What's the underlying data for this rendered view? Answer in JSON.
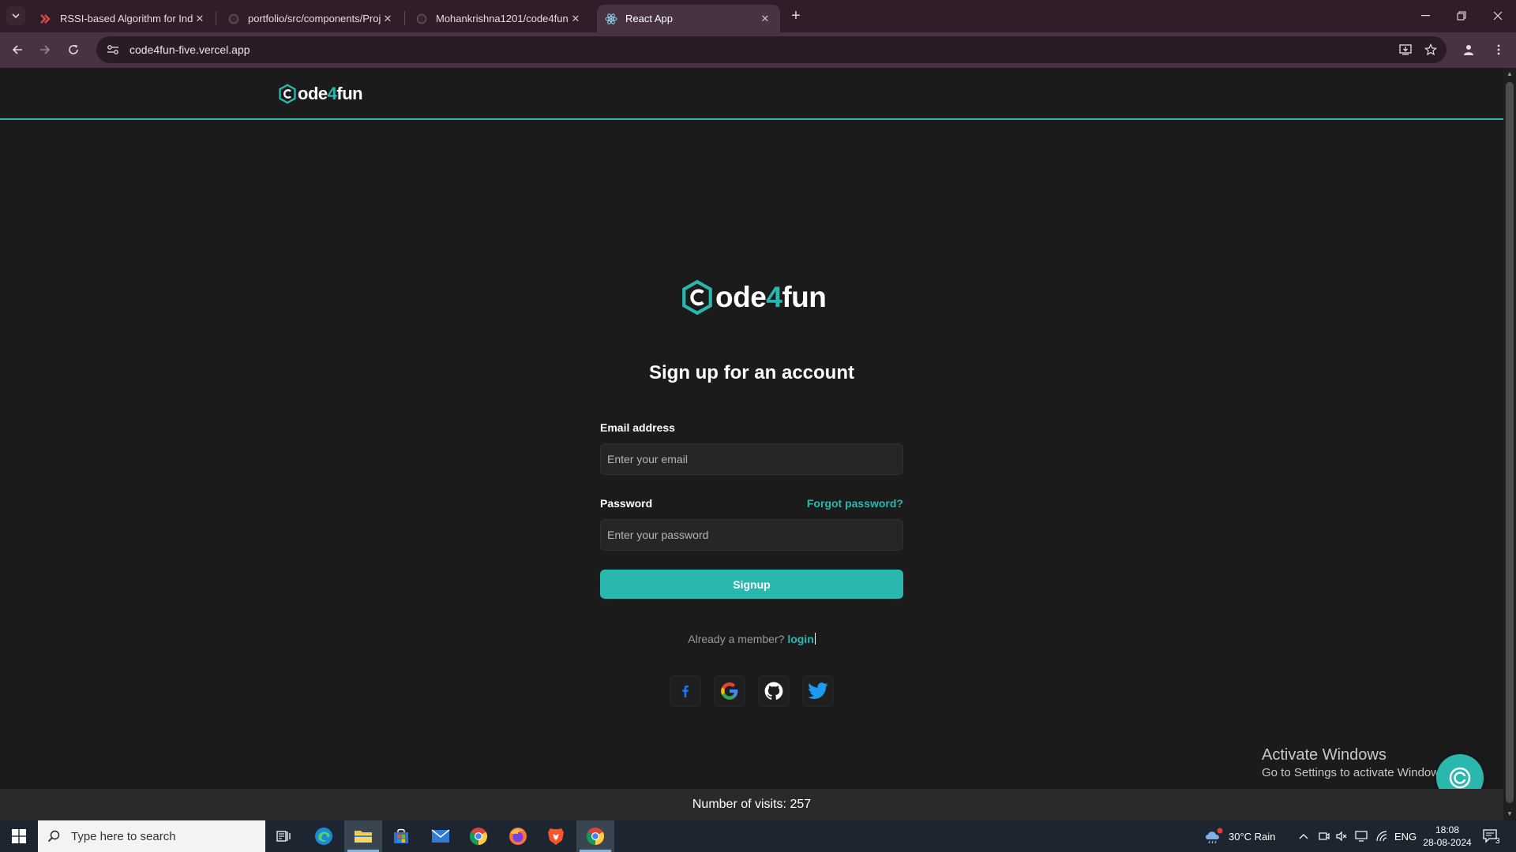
{
  "browser": {
    "tabs": [
      {
        "title": "RSSI-based Algorithm for Indoor",
        "active": false
      },
      {
        "title": "portfolio/src/components/Proje",
        "active": false
      },
      {
        "title": "Mohankrishna1201/code4fun",
        "active": false
      },
      {
        "title": "React App",
        "active": true
      }
    ],
    "url": "code4fun-five.vercel.app"
  },
  "site": {
    "logo": {
      "prefix": "ode",
      "accent": "4",
      "suffix": "fun"
    },
    "form_title": "Sign up for an account",
    "email_label": "Email address",
    "email_placeholder": "Enter your email",
    "password_label": "Password",
    "forgot_label": "Forgot password?",
    "password_placeholder": "Enter your password",
    "signup_label": "Signup",
    "member_text": "Already a member?",
    "login_label": "login",
    "socials": [
      "facebook-icon",
      "google-icon",
      "github-icon",
      "twitter-icon"
    ],
    "visits": "Number of visits: 257",
    "accent_color": "#2ab7ae"
  },
  "watermark": {
    "line1": "Activate Windows",
    "line2": "Go to Settings to activate Windows."
  },
  "taskbar": {
    "search_placeholder": "Type here to search",
    "weather": "30°C  Rain",
    "language": "ENG",
    "time": "18:08",
    "date": "28-08-2024",
    "notification_count": "3"
  }
}
